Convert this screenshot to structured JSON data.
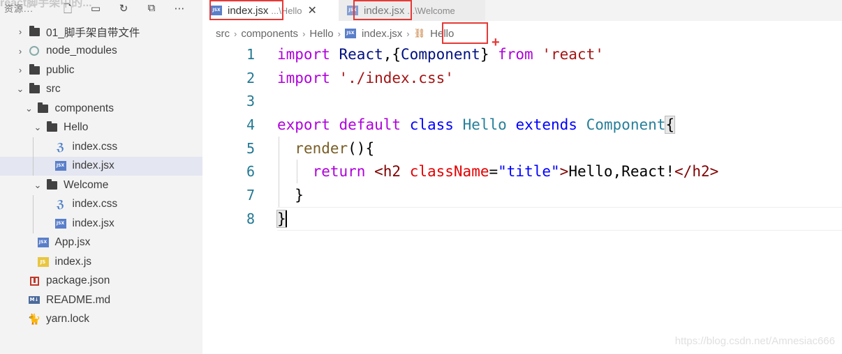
{
  "sidebar": {
    "overlay_text": "react脚手架中的...",
    "title": "资源...",
    "actions": [
      {
        "icon": "new-file-icon",
        "glyph": "🗋"
      },
      {
        "icon": "new-folder-icon",
        "glyph": "▭"
      },
      {
        "icon": "refresh-icon",
        "glyph": "↻"
      },
      {
        "icon": "collapse-all-icon",
        "glyph": "⧉"
      },
      {
        "icon": "more-icon",
        "glyph": "⋯"
      }
    ],
    "tree": [
      {
        "label": "01_脚手架自带文件",
        "type": "folder",
        "expanded": false
      },
      {
        "label": "node_modules",
        "type": "node_modules",
        "expanded": false
      },
      {
        "label": "public",
        "type": "folder",
        "expanded": false
      },
      {
        "label": "src",
        "type": "folder",
        "expanded": true
      },
      {
        "label": "components",
        "type": "folder",
        "expanded": true
      },
      {
        "label": "Hello",
        "type": "folder",
        "expanded": true
      },
      {
        "label": "index.css",
        "type": "css"
      },
      {
        "label": "index.jsx",
        "type": "jsx",
        "selected": true
      },
      {
        "label": "Welcome",
        "type": "folder",
        "expanded": true
      },
      {
        "label": "index.css",
        "type": "css"
      },
      {
        "label": "index.jsx",
        "type": "jsx"
      },
      {
        "label": "App.jsx",
        "type": "jsx"
      },
      {
        "label": "index.js",
        "type": "js"
      },
      {
        "label": "package.json",
        "type": "package"
      },
      {
        "label": "README.md",
        "type": "md"
      },
      {
        "label": "yarn.lock",
        "type": "yarn"
      }
    ]
  },
  "tabs": {
    "active": {
      "label": "index.jsx",
      "description": "...\\Hello",
      "close": "✕"
    },
    "inactive": {
      "label": "index.jsx",
      "description": "...\\Welcome"
    }
  },
  "icons": {
    "jsx": "JSX",
    "js": "JS",
    "css": "ℨ",
    "md": "M↓"
  },
  "breadcrumb": {
    "items": [
      "src",
      "components",
      "Hello",
      "index.jsx",
      "Hello"
    ],
    "separator": "›",
    "symbol_icon": "⛓"
  },
  "code": {
    "line_numbers": [
      "1",
      "2",
      "3",
      "4",
      "5",
      "6",
      "7",
      "8"
    ]
  },
  "watermark": "https://blog.csdn.net/Amnesiac666",
  "colors": {
    "keyword": "#af00db",
    "storage": "#0000ff",
    "type": "#267f99",
    "string": "#a31515",
    "annotation_red": "#e53935",
    "line_number": "#237893"
  }
}
